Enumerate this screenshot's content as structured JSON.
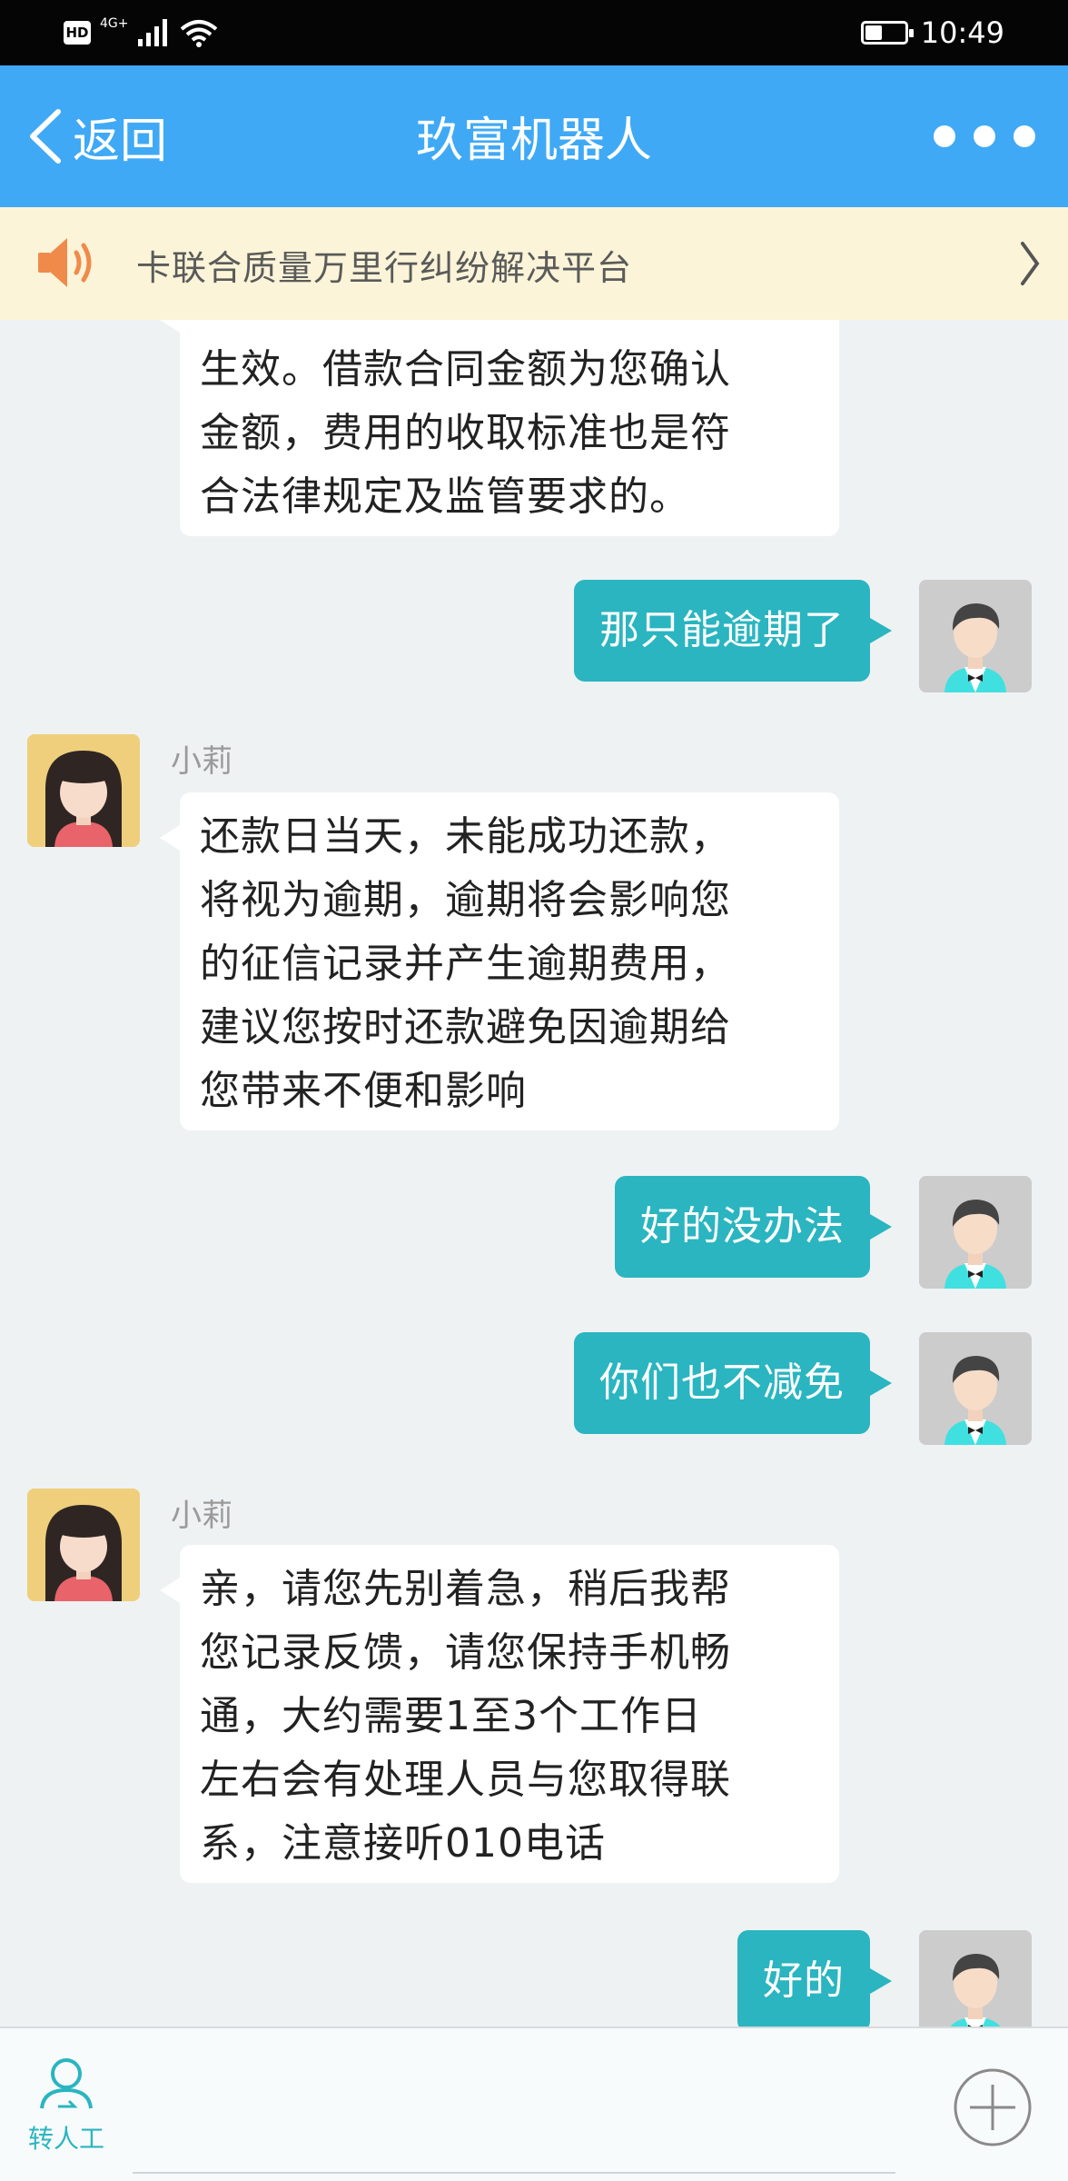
{
  "status_bar": {
    "hd": "HD",
    "network": "4G+",
    "time": "10:49",
    "icons": [
      "signal-icon",
      "wifi-icon",
      "battery-icon"
    ]
  },
  "header": {
    "back_label": "返回",
    "title": "玖富机器人",
    "background": "#3fa9f5"
  },
  "notice": {
    "text": "卡联合质量万里行纠纷解决平台"
  },
  "chat": {
    "bot_name": "小莉",
    "messages": [
      {
        "from": "bot",
        "lines": [
          "生效。借款合同金额为您确认",
          "金额，费用的收取标准也是符",
          "合法律规定及监管要求的。"
        ]
      },
      {
        "from": "user",
        "text": "那只能逾期了"
      },
      {
        "from": "bot",
        "name": "小莉",
        "lines": [
          "还款日当天，未能成功还款，",
          "将视为逾期，逾期将会影响您",
          "的征信记录并产生逾期费用，",
          "建议您按时还款避免因逾期给",
          "您带来不便和影响"
        ]
      },
      {
        "from": "user",
        "text": "好的没办法"
      },
      {
        "from": "user",
        "text": "你们也不减免"
      },
      {
        "from": "bot",
        "name": "小莉",
        "lines": [
          "亲，请您先别着急，稍后我帮",
          "您记录反馈，请您保持手机畅",
          "通，大约需要1至3个工作日",
          "左右会有处理人员与您取得联",
          "系，注意接听010电话"
        ]
      },
      {
        "from": "user",
        "text": "好的"
      }
    ],
    "user_bubble_color": "#2ab5c0"
  },
  "bottom_bar": {
    "transfer_label": "转人工"
  }
}
